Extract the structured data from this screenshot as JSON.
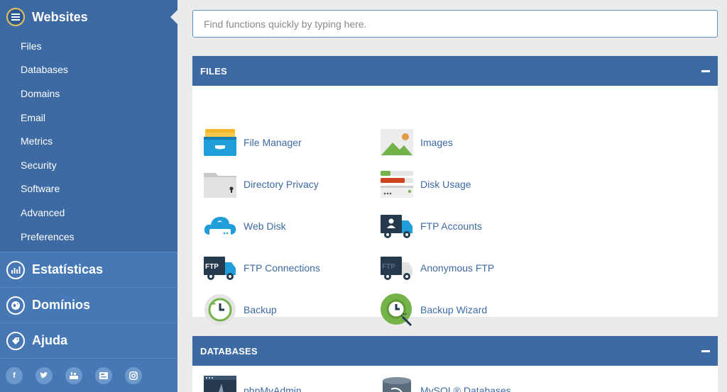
{
  "sidebar": {
    "header": {
      "title": "Websites",
      "icon": "list-icon"
    },
    "items": [
      {
        "label": "Files"
      },
      {
        "label": "Databases"
      },
      {
        "label": "Domains"
      },
      {
        "label": "Email"
      },
      {
        "label": "Metrics"
      },
      {
        "label": "Security"
      },
      {
        "label": "Software"
      },
      {
        "label": "Advanced"
      },
      {
        "label": "Preferences"
      }
    ],
    "groups": [
      {
        "title": "Estatísticas",
        "icon": "bar-chart-icon"
      },
      {
        "title": "Domínios",
        "icon": "globe-icon"
      },
      {
        "title": "Ajuda",
        "icon": "tag-icon"
      }
    ],
    "social": [
      "facebook-icon",
      "twitter-icon",
      "youtube-icon",
      "blog-icon",
      "instagram-icon"
    ]
  },
  "search": {
    "placeholder": "Find functions quickly by typing here."
  },
  "panels": [
    {
      "title": "FILES",
      "tools": [
        {
          "label": "File Manager",
          "icon": "file-manager-icon"
        },
        {
          "label": "Images",
          "icon": "images-icon"
        },
        {
          "label": "Directory Privacy",
          "icon": "directory-privacy-icon"
        },
        {
          "label": "Disk Usage",
          "icon": "disk-usage-icon"
        },
        {
          "label": "Web Disk",
          "icon": "web-disk-icon"
        },
        {
          "label": "FTP Accounts",
          "icon": "ftp-accounts-icon"
        },
        {
          "label": "FTP Connections",
          "icon": "ftp-connections-icon"
        },
        {
          "label": "Anonymous FTP",
          "icon": "anonymous-ftp-icon"
        },
        {
          "label": "Backup",
          "icon": "backup-icon"
        },
        {
          "label": "Backup Wizard",
          "icon": "backup-wizard-icon"
        }
      ]
    },
    {
      "title": "DATABASES",
      "tools": [
        {
          "label": "phpMyAdmin",
          "icon": "phpmyadmin-icon"
        },
        {
          "label": "MySQL® Databases",
          "icon": "mysql-databases-icon"
        }
      ]
    }
  ],
  "colors": {
    "sidebar": "#3d6aa3",
    "accent": "#3d6aa3",
    "link": "#3d6aa3",
    "background": "#ebebeb"
  }
}
